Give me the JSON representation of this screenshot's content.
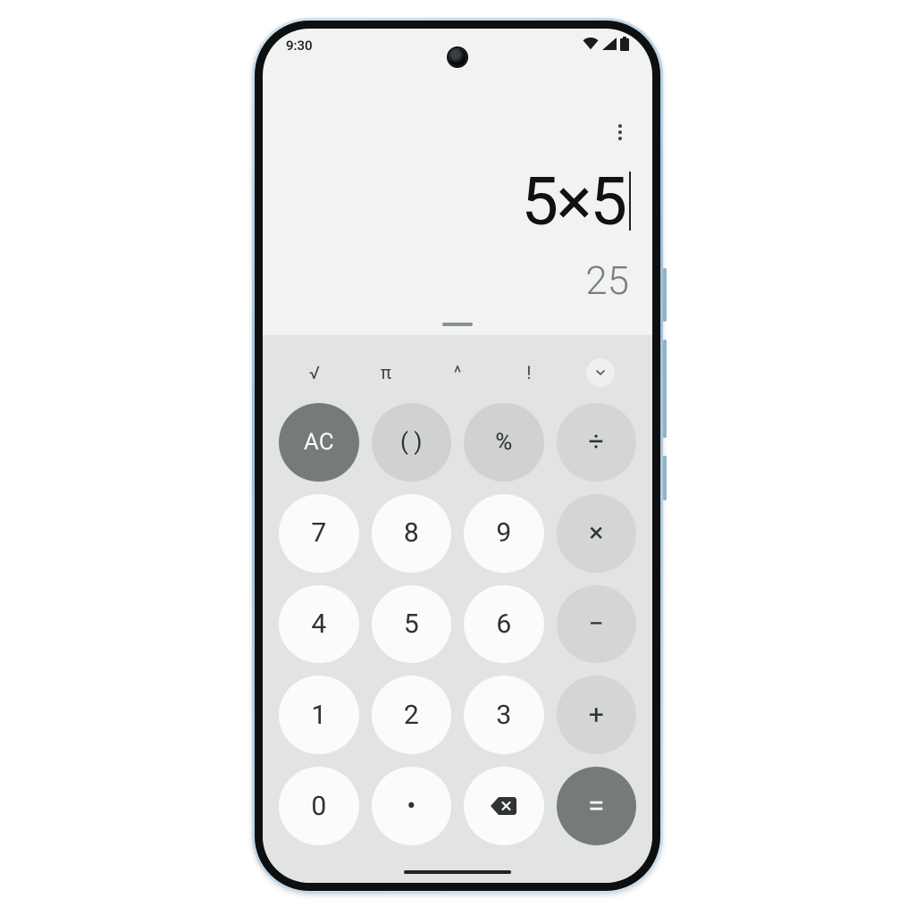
{
  "status": {
    "time": "9:30"
  },
  "calc": {
    "expression": "5×5",
    "result": "25"
  },
  "fn": {
    "sqrt": "√",
    "pi": "π",
    "pow": "^",
    "fact": "!"
  },
  "keys": {
    "ac": "AC",
    "paren": "( )",
    "percent": "%",
    "divide": "÷",
    "multiply": "×",
    "minus": "−",
    "plus": "+",
    "equals": "=",
    "dot": "•",
    "n0": "0",
    "n1": "1",
    "n2": "2",
    "n3": "3",
    "n4": "4",
    "n5": "5",
    "n6": "6",
    "n7": "7",
    "n8": "8",
    "n9": "9"
  }
}
